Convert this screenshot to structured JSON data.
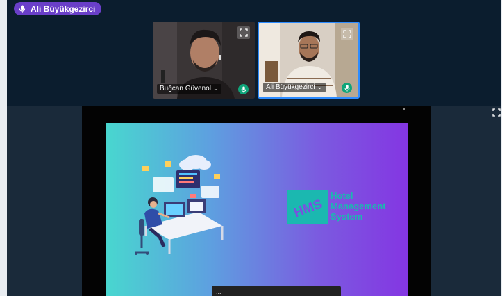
{
  "talking_indicator": {
    "label": "Ali Büyükgezirci",
    "color": "#6a3fc9"
  },
  "video_tiles": [
    {
      "name": "Buğcan Güvenol",
      "caret": "⌄",
      "mic": "unmuted"
    },
    {
      "name": "Ali Büyükgezirci",
      "caret": "⌄",
      "mic": "unmuted",
      "active_speaker": true
    }
  ],
  "presentation": {
    "slide": {
      "logo_text": "HMS",
      "title_lines": [
        "Hotel",
        "Management",
        "System"
      ]
    },
    "caption_text": "..."
  },
  "colors": {
    "app_background": "#0b1d2e",
    "active_border": "#2d8cff",
    "mic_on": "#0fa57a",
    "slide_text": "#1bb8b0"
  },
  "icons": [
    "microphone-icon",
    "expand-icon",
    "chevron-down-icon"
  ]
}
